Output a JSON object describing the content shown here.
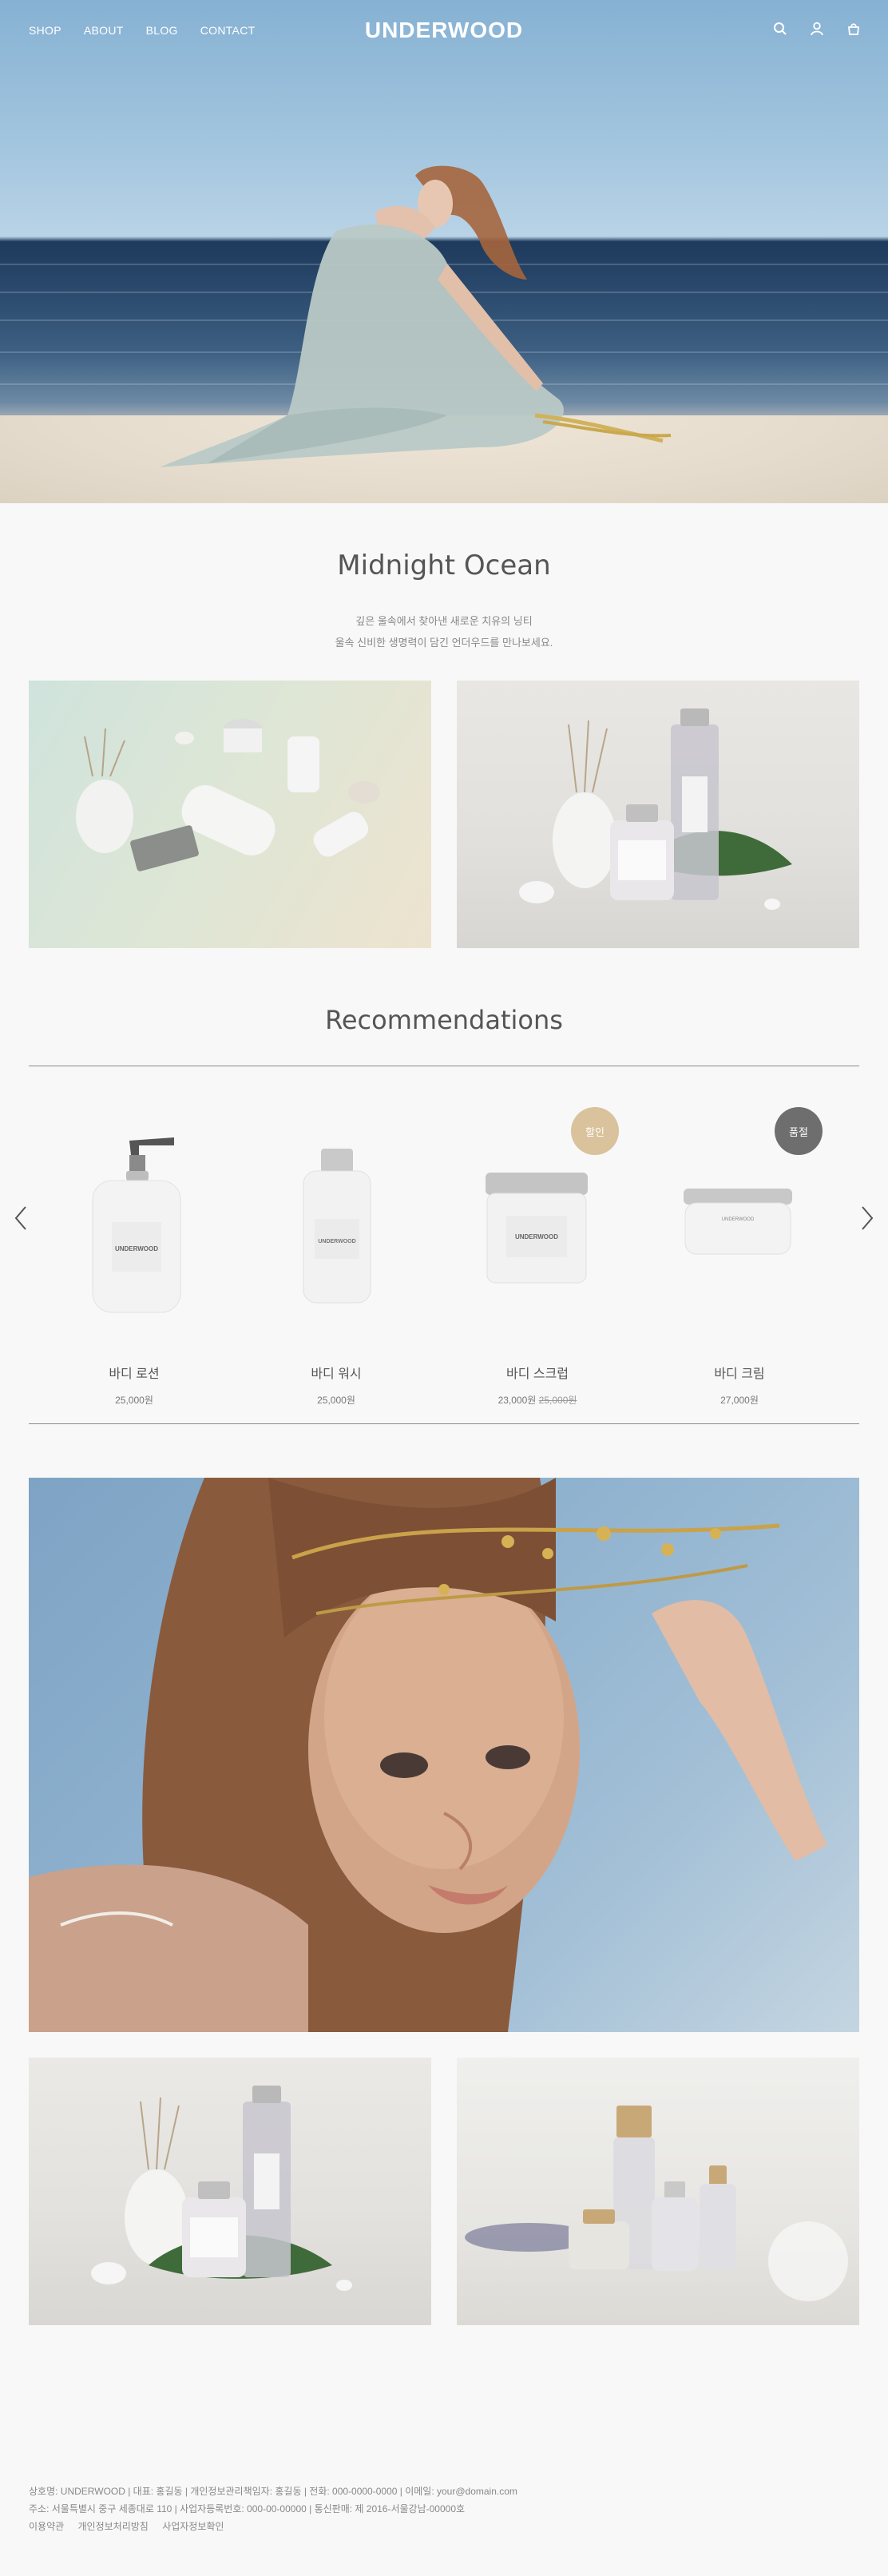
{
  "header": {
    "menu": [
      "SHOP",
      "ABOUT",
      "BLOG",
      "CONTACT"
    ],
    "logo": "UNDERWOOD",
    "icons": [
      "search-icon",
      "user-icon",
      "shopping-bag-icon"
    ]
  },
  "intro": {
    "title": "Midnight Ocean",
    "lines": [
      "깊은 울속에서 찾아낸 새로운 치유의 닝티",
      "울속 신비한 생명력이 담긴 언더우드를 만나보세요."
    ]
  },
  "recommend": {
    "title": "Recommendations",
    "products": [
      {
        "name": "바디 로션",
        "price": "25,000원",
        "old_price": "",
        "badge": ""
      },
      {
        "name": "바디 워시",
        "price": "25,000원",
        "old_price": "",
        "badge": ""
      },
      {
        "name": "바디 스크럽",
        "price": "23,000원",
        "old_price": "25,000원",
        "badge": "할인"
      },
      {
        "name": "바디 크림",
        "price": "27,000원",
        "old_price": "",
        "badge": "품절"
      }
    ],
    "badge_colors": {
      "sale": "#d9c29c",
      "soldout": "#6e6e6e"
    }
  },
  "footer": {
    "line1": "상호명: UNDERWOOD | 대표: 홍길동 | 개인정보관리책임자: 홍길동 | 전화: 000-0000-0000 | 이메일: your@domain.com",
    "line2": "주소: 서울특별시 중구 세종대로 110 | 사업자등록번호: 000-00-00000 | 통신판매: 제 2016-서울강남-00000호",
    "links": [
      "이용약관",
      "개인정보처리방침",
      "사업자정보확인"
    ]
  }
}
